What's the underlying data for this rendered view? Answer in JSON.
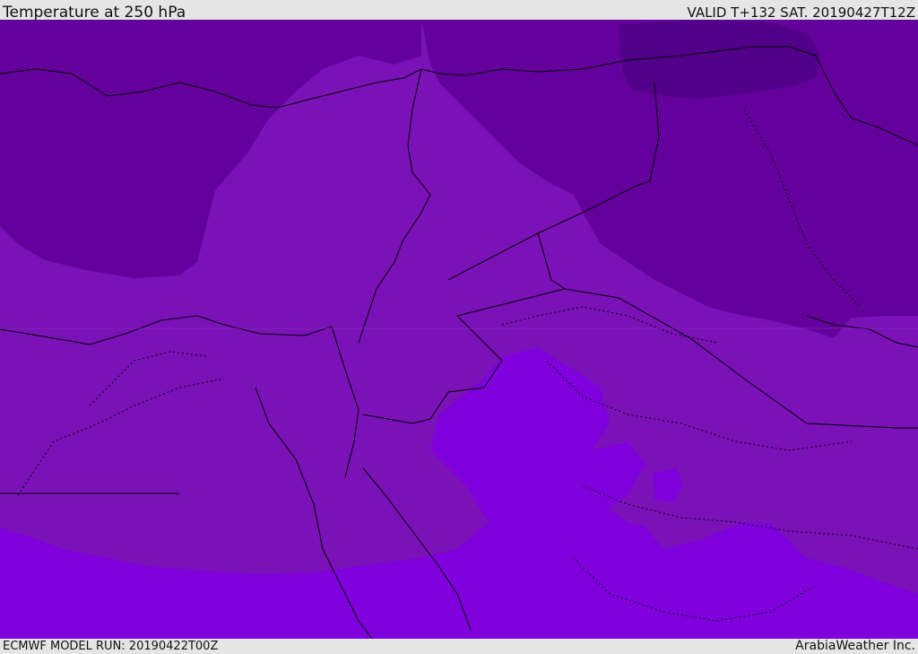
{
  "header": {
    "title": "Temperature at 250 hPa",
    "valid_time": "VALID T+132 SAT. 20190427T12Z"
  },
  "footer": {
    "model_run": "ECMWF MODEL RUN: 20190422T00Z",
    "credit": "ArabiaWeather Inc."
  },
  "map": {
    "colors": {
      "coldest_band": "#52008a",
      "cold_band": "#64009c",
      "mid_band": "#7a12b8",
      "warm_band": "#7f00dc",
      "border_line": "#000000"
    }
  }
}
